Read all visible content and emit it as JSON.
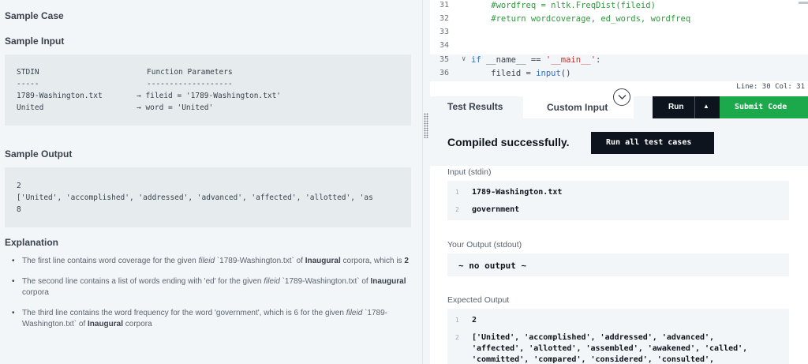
{
  "problem": {
    "sample_case_heading": "Sample Case",
    "sample_input_heading": "Sample Input",
    "sample_input": {
      "header_left": "STDIN",
      "header_right": "Function Parameters",
      "underline_left": "-----",
      "underline_right": "-------------------",
      "row1_left": "1789-Washington.txt",
      "row1_right": "→ fileid = '1789-Washington.txt'",
      "row2_left": "United",
      "row2_right": "→ word = 'United'"
    },
    "sample_output_heading": "Sample Output",
    "sample_output_lines": [
      "2",
      "['United', 'accomplished', 'addressed', 'advanced', 'affected', 'allotted', 'as",
      "8"
    ],
    "explanation_heading": "Explanation",
    "explanations": [
      {
        "pre": "The first line contains word coverage for the given ",
        "em": "fileid",
        "mid": " `1789-Washington.txt` of ",
        "bold": "Inaugural",
        "post": " corpora, which is ",
        "bold2": "2"
      },
      {
        "pre": "The second line contains a list of words ending with 'ed' for the given ",
        "em": "fileid",
        "mid": " `1789-Washington.txt` of ",
        "bold": "Inaugural",
        "post": " corpora",
        "bold2": ""
      },
      {
        "pre": "The third line contains the word frequency for the word 'government', which is 6 for the given ",
        "em": "fileid",
        "mid": " `1789-Washington.txt` of ",
        "bold": "Inaugural",
        "post": " corpora",
        "bold2": ""
      }
    ]
  },
  "editor": {
    "lines": [
      {
        "num": "31",
        "fold": "",
        "parts": [
          {
            "c": "cm",
            "t": "    #wordfreq = nltk.FreqDist(fileid)"
          }
        ]
      },
      {
        "num": "32",
        "fold": "",
        "parts": [
          {
            "c": "cm",
            "t": "    #return wordcoverage, ed_words, wordfreq"
          }
        ]
      },
      {
        "num": "33",
        "fold": "",
        "parts": []
      },
      {
        "num": "34",
        "fold": "",
        "parts": []
      },
      {
        "num": "35",
        "fold": "∨",
        "parts": [
          {
            "c": "kw",
            "t": "if "
          },
          {
            "c": "tx",
            "t": "__name__ == "
          },
          {
            "c": "st",
            "t": "'__main__'"
          },
          {
            "c": "tx",
            "t": ":"
          }
        ]
      },
      {
        "num": "36",
        "fold": "",
        "parts": [
          {
            "c": "tx",
            "t": "    fileid = "
          },
          {
            "c": "kw",
            "t": "input"
          },
          {
            "c": "tx",
            "t": "()"
          }
        ]
      }
    ],
    "status": "Line: 30 Col: 31"
  },
  "tabs": {
    "test_results": "Test Results",
    "custom_input": "Custom Input"
  },
  "buttons": {
    "run": "Run",
    "run_arrow": "▲",
    "submit": "Submit Code",
    "run_all": "Run all test cases"
  },
  "results": {
    "compiled": "Compiled successfully.",
    "input_label": "Input (stdin)",
    "input_lines": [
      {
        "num": "1",
        "text": "1789-Washington.txt"
      },
      {
        "num": "2",
        "text": "government"
      }
    ],
    "output_label": "Your Output (stdout)",
    "output_text": "~ no output ~",
    "expected_label": "Expected Output",
    "expected_lines": [
      {
        "num": "1",
        "text": "2"
      },
      {
        "num": "2",
        "text": "['United', 'accomplished', 'addressed', 'advanced',"
      },
      {
        "num": "",
        "text": "'affected', 'allotted', 'assembled', 'awakened', 'called',"
      },
      {
        "num": "",
        "text": "'committed', 'compared', 'considered', 'consulted',"
      }
    ]
  },
  "colors": {
    "accent_green": "#1ba94c",
    "dark": "#0e141e",
    "panel_bg": "#f3f6f8"
  }
}
